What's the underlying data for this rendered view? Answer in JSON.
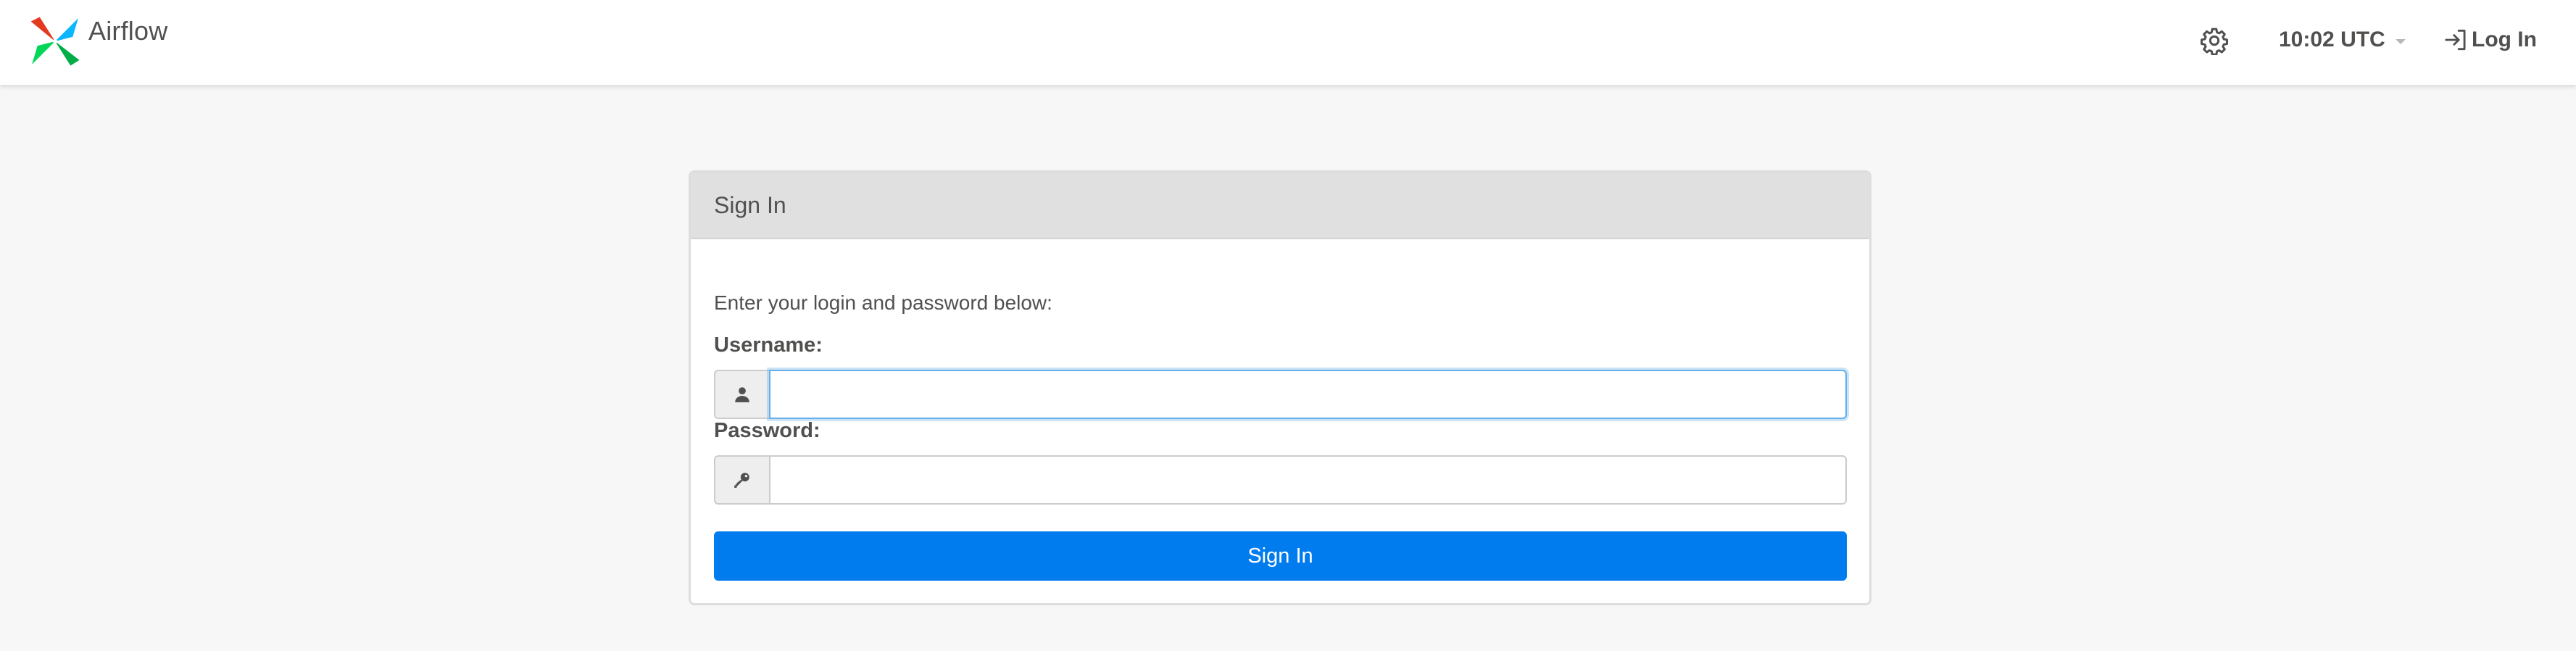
{
  "navbar": {
    "brand": "Airflow",
    "time": "10:02 UTC",
    "login_label": "Log In"
  },
  "icons": {
    "logo": "airflow-pinwheel-logo",
    "settings": "gear-icon",
    "login": "sign-in-icon",
    "username": "user-icon",
    "password": "key-icon"
  },
  "colors": {
    "primary": "#017cee",
    "logo_red": "#e43921",
    "logo_green": "#00ad46",
    "logo_teal": "#04d659",
    "logo_blue": "#0cb6ff"
  },
  "signin": {
    "title": "Sign In",
    "helper": "Enter your login and password below:",
    "username_label": "Username:",
    "username_value": "",
    "password_label": "Password:",
    "password_value": "",
    "button_label": "Sign In"
  }
}
